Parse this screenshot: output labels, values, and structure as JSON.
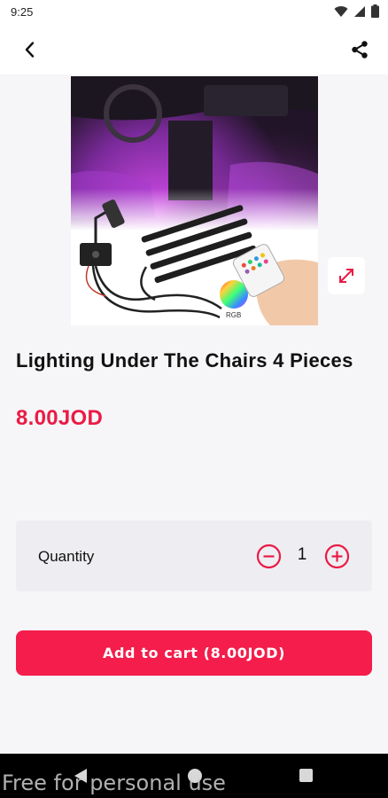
{
  "status_bar": {
    "time": "9:25",
    "icons": [
      "wifi-icon",
      "signal-icon",
      "battery-icon"
    ]
  },
  "app_bar": {
    "back_icon": "back-arrow-icon",
    "share_icon": "share-icon"
  },
  "product": {
    "image_icon": "product-photo",
    "image_badge": "RGB",
    "title": "Lighting Under The Chairs 4 Pieces",
    "price": "8.00JOD",
    "expand_icon": "expand-icon"
  },
  "quantity": {
    "label": "Quantity",
    "value": "1",
    "minus_icon": "minus-circle-icon",
    "plus_icon": "plus-circle-icon"
  },
  "cart": {
    "button_label": "Add to cart (8.00JOD)"
  },
  "nav_bar": {
    "icons": [
      "nav-back-icon",
      "nav-home-icon",
      "nav-recents-icon"
    ]
  },
  "watermark": "Free for personal use",
  "colors": {
    "accent": "#f41d4b",
    "price": "#ea1b45",
    "background": "#f6f6f8",
    "card": "#eeeef2"
  }
}
